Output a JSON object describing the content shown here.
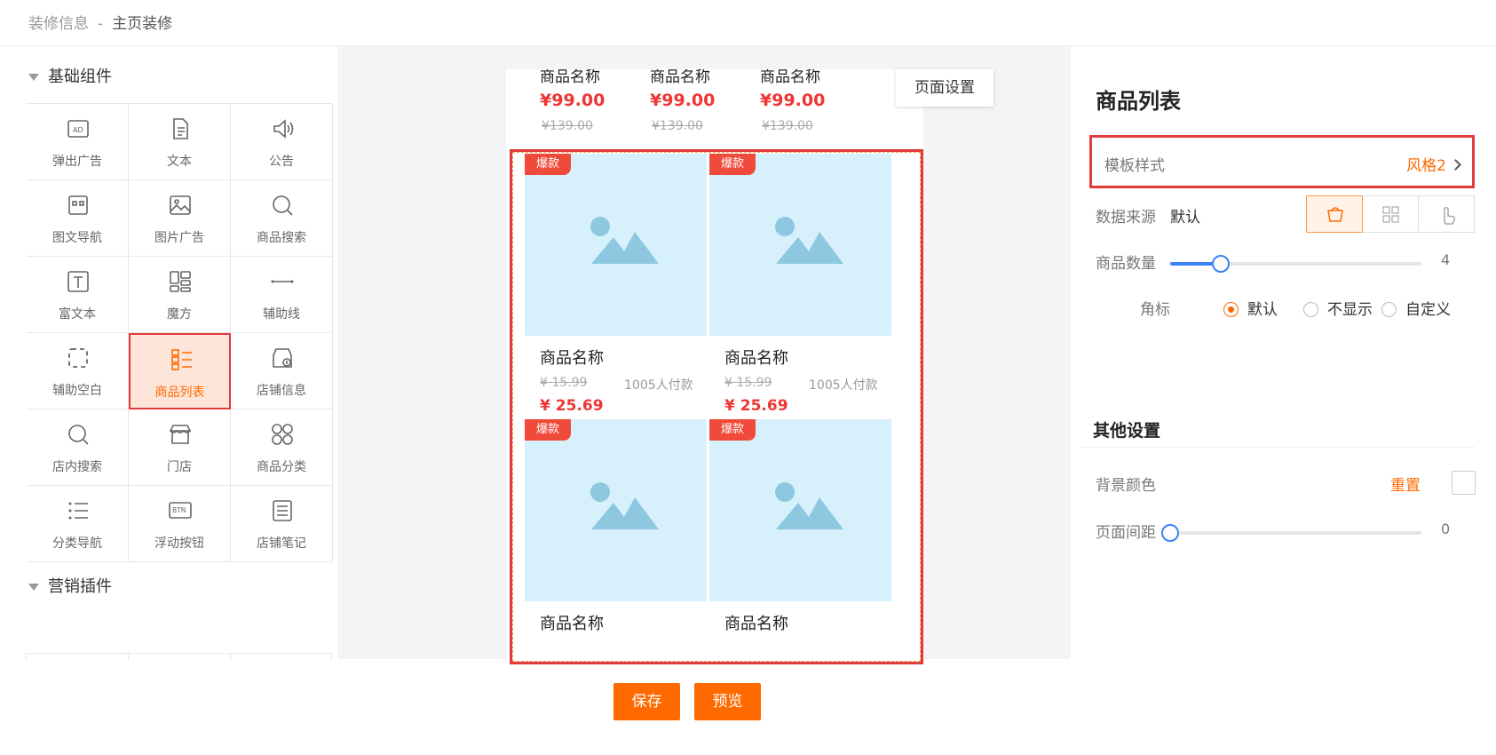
{
  "breadcrumb": {
    "parent": "装修信息",
    "sep": "-",
    "current": "主页装修"
  },
  "left": {
    "group1_title": "基础组件",
    "group2_title": "营销插件",
    "components": [
      {
        "label": "弹出广告",
        "icon": "ad-icon"
      },
      {
        "label": "文本",
        "icon": "document-icon"
      },
      {
        "label": "公告",
        "icon": "speaker-icon"
      },
      {
        "label": "图文导航",
        "icon": "image-nav-icon"
      },
      {
        "label": "图片广告",
        "icon": "picture-icon"
      },
      {
        "label": "商品搜索",
        "icon": "search-icon"
      },
      {
        "label": "富文本",
        "icon": "text-t-icon"
      },
      {
        "label": "魔方",
        "icon": "cube-grid-icon"
      },
      {
        "label": "辅助线",
        "icon": "line-icon"
      },
      {
        "label": "辅助空白",
        "icon": "dashed-box-icon"
      },
      {
        "label": "商品列表",
        "icon": "list-icon",
        "active": true
      },
      {
        "label": "店铺信息",
        "icon": "shop-info-icon"
      },
      {
        "label": "店内搜索",
        "icon": "search-icon"
      },
      {
        "label": "门店",
        "icon": "store-icon"
      },
      {
        "label": "商品分类",
        "icon": "category-icon"
      },
      {
        "label": "分类导航",
        "icon": "bullet-list-icon"
      },
      {
        "label": "浮动按钮",
        "icon": "btn-icon"
      },
      {
        "label": "店铺笔记",
        "icon": "note-icon"
      }
    ]
  },
  "canvas": {
    "top_strip": [
      {
        "name": "商品名称",
        "price": "¥99.00",
        "orig": "¥139.00"
      },
      {
        "name": "商品名称",
        "price": "¥99.00",
        "orig": "¥139.00"
      },
      {
        "name": "商品名称",
        "price": "¥99.00",
        "orig": "¥139.00"
      }
    ],
    "page_settings_btn": "页面设置",
    "products": [
      {
        "badge": "爆款",
        "name": "商品名称",
        "orig": "¥ 15.99",
        "sold": "1005人付款",
        "price": "¥ 25.69"
      },
      {
        "badge": "爆款",
        "name": "商品名称",
        "orig": "¥ 15.99",
        "sold": "1005人付款",
        "price": "¥ 25.69"
      },
      {
        "badge": "爆款",
        "name": "商品名称"
      },
      {
        "badge": "爆款",
        "name": "商品名称"
      }
    ],
    "save_btn": "保存",
    "preview_btn": "预览"
  },
  "panel": {
    "title": "商品列表",
    "template_label": "模板样式",
    "template_value": "风格2",
    "source_label": "数据来源",
    "source_value": "默认",
    "count_label": "商品数量",
    "count_value": "4",
    "count_fraction": 0.2,
    "corner_label": "角标",
    "corner_options": [
      "默认",
      "不显示",
      "自定义"
    ],
    "corner_selected": 0,
    "other_title": "其他设置",
    "bg_label": "背景颜色",
    "bg_reset": "重置",
    "margin_label": "页面间距",
    "margin_value": "0",
    "margin_fraction": 0,
    "accent": "#ff6a00",
    "highlight": "#e23b3b"
  }
}
